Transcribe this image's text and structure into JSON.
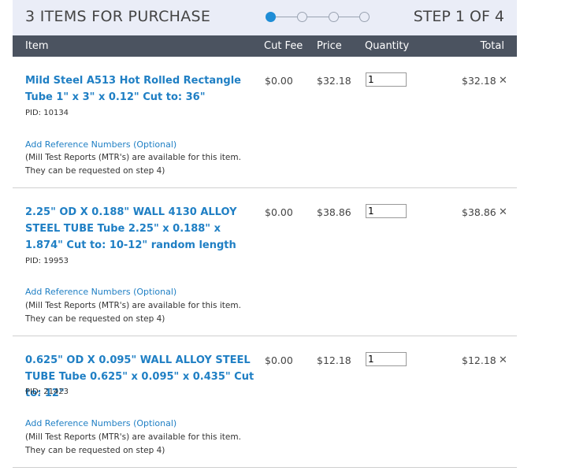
{
  "header": {
    "title": "3 ITEMS FOR PURCHASE",
    "step": "STEP 1 OF 4",
    "progress": {
      "total_steps": 4,
      "current_step": 1
    }
  },
  "columns": {
    "item": "Item",
    "cut_fee": "Cut Fee",
    "price": "Price",
    "quantity": "Quantity",
    "total": "Total"
  },
  "items": [
    {
      "name": "Mild Steel A513 Hot Rolled Rectangle Tube 1\" x 3\" x 0.12\" Cut to: 36\"",
      "pid": "PID: 10134",
      "cut_fee": "$0.00",
      "price": "$32.18",
      "quantity": "1",
      "total": "$32.18",
      "ref_link": "Add Reference Numbers (Optional)",
      "mtr_line1": "(Mill Test Reports (MTR's) are available for this item.",
      "mtr_line2": "They can be requested on step 4)"
    },
    {
      "name": "2.25\" OD X 0.188\" WALL 4130 ALLOY STEEL TUBE Tube 2.25\" x 0.188\" x 1.874\" Cut to: 10-12\" random length",
      "pid": "PID: 19953",
      "cut_fee": "$0.00",
      "price": "$38.86",
      "quantity": "1",
      "total": "$38.86",
      "ref_link": "Add Reference Numbers (Optional)",
      "mtr_line1": "(Mill Test Reports (MTR's) are available for this item.",
      "mtr_line2": "They can be requested on step 4)"
    },
    {
      "name": "0.625\" OD X 0.095\" WALL ALLOY STEEL TUBE Tube 0.625\" x 0.095\" x 0.435\" Cut to: 12\"",
      "pid": "PID: 21423",
      "cut_fee": "$0.00",
      "price": "$12.18",
      "quantity": "1",
      "total": "$12.18",
      "ref_link": "Add Reference Numbers (Optional)",
      "mtr_line1": "(Mill Test Reports (MTR's) are available for this item.",
      "mtr_line2": "They can be requested on step 4)"
    }
  ],
  "icons": {
    "remove": "close-icon",
    "remove_glyph": "✕"
  }
}
